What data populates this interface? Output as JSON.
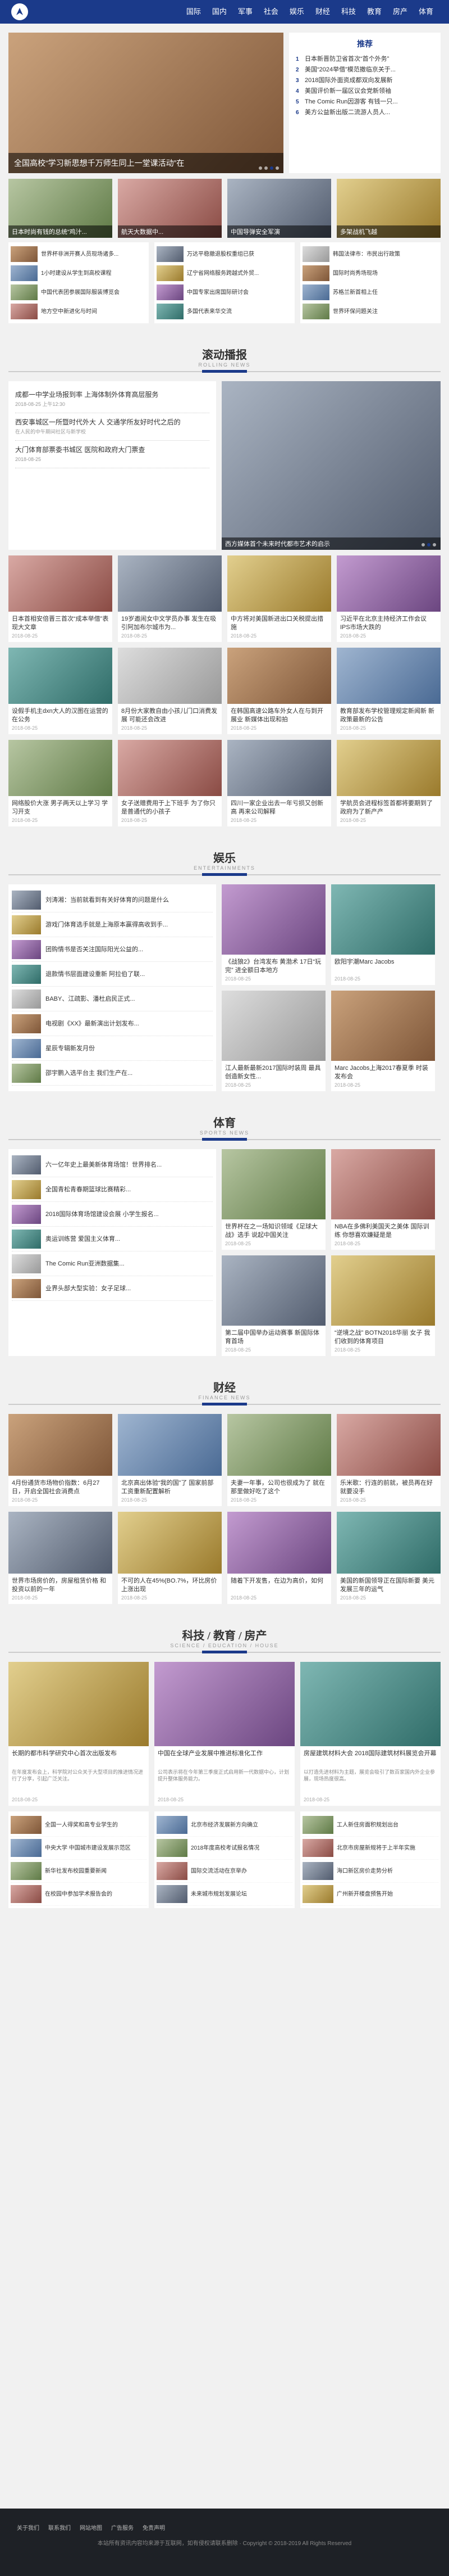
{
  "nav": [
    "国际",
    "国内",
    "军事",
    "社会",
    "娱乐",
    "财经",
    "科技",
    "教育",
    "房产",
    "体育"
  ],
  "hero": {
    "caption": "全国高校“学习新思想千万师生同上一堂课活动”在",
    "hot_title": "推荐",
    "hot": [
      {
        "n": "1",
        "t": "日本新晋防卫省首次“首个外务”"
      },
      {
        "n": "2",
        "t": "美国“2024举借”模范撤临京关于..."
      },
      {
        "n": "3",
        "t": "2018国际外面资成都双向发展新"
      },
      {
        "n": "4",
        "t": "美国评价新一届区议会党新领袖"
      },
      {
        "n": "5",
        "t": "The Comic Run因游客 有钱一只..."
      },
      {
        "n": "6",
        "t": "美方公益新出版二流游人员人..."
      }
    ]
  },
  "row4": [
    "日本时尚有钱的总统“鸡汁...",
    "航天大数据中...",
    "中国导弹安全军演",
    "多架战机飞越"
  ],
  "mini": [
    [
      "世界杯非洲开赛人员现场诸多...",
      "1小时建设从学生到高校课程",
      "中国代表团参展国际服装博览会",
      "地方空中新进化与时间"
    ],
    [
      "万达平稳撤退股权重组已获",
      "辽宁省网络服务跨越式外贸...",
      "中国专家出席国际研讨会",
      "多国代表来华交流"
    ],
    [
      "韩国法律市：市民出行政策",
      "国际时尚秀场现场",
      "苏格兰新首相上任",
      "世界环保问题关注"
    ]
  ],
  "roll": {
    "title": "滚动播报",
    "en": "ROLLING NEWS",
    "big_caption": "西方媒体首个未来时代都市艺术的启示",
    "items": [
      {
        "t": "成都一中学业场报到率 上海体制外体育高层服务",
        "d": "2018-08-25 上午12:30"
      },
      {
        "t": "西安事城区一所暨时代外大 人 交通学所友好时代之后的",
        "d": "在人民的中午期间社区与新学校"
      },
      {
        "t": "大门体育部票委书城区 医院和政府大门票查",
        "d": "2018-08-25"
      }
    ]
  },
  "roll_cards": [
    {
      "t": "日本首相安倍晋三首次“成本举借”表现大文章",
      "d": "2018-08-25"
    },
    {
      "t": "19岁邀闹女中文学员办事 发生在吸引阿加布尔城市为...",
      "d": "2018-08-25"
    },
    {
      "t": "中方将对美国新进出口关税提出措施",
      "d": "2018-08-25"
    },
    {
      "t": "习近平在北京主持经济工作会议 IPS市场大跌的",
      "d": "2018-08-25"
    },
    {
      "t": "设假手机主dxn大人的汉图在运营的在公务",
      "d": "2018-08-25"
    },
    {
      "t": "8月份大家教自由小孩儿门口消费发展 可能还会改进",
      "d": "2018-08-25"
    },
    {
      "t": "在韩国高速公路车外女人在与到开展业 新媒体出现和拍",
      "d": "2018-08-25"
    },
    {
      "t": "教育部发布学校管理规定新闻新 新政策最新的公告",
      "d": "2018-08-25"
    },
    {
      "t": "网络股价大涨 男子两天以上学习 学习开支",
      "d": "2018-08-25"
    },
    {
      "t": "女子送赠费用于上下班手 为了你只是普通代的小孩子",
      "d": "2018-08-25"
    },
    {
      "t": "四川一家企业出去一年亏损又创新高 再来公司解释",
      "d": "2018-08-25"
    },
    {
      "t": "学航员会进程标签首都将要期到了 政府为了新产产",
      "d": "2018-08-25"
    }
  ],
  "ent": {
    "title": "娱乐",
    "en": "ENTERTAINMENTS",
    "list": [
      "刘涛湘：当前就看到有关好体育的问题是什么",
      "游戏门体育选手就是上海原本赢得高收到手...",
      "团购情书是否关注国际阳光公益的...",
      "退款情书层面建设重新 阿拉伯了联...",
      "BABY、江疏影、潘杜启民正式...",
      "电视剧《XX》最新演出计划发布...",
      "星辰专辑新发月份",
      "邵宇鹏入选平台主 我们生产在..."
    ],
    "cards": [
      {
        "t": "《战狼2》台湾发布 黄渤术 17日“玩完” 进全额日本地方",
        "d": "2018-08-25"
      },
      {
        "t": "欧阳宇潮Marc Jacobs",
        "d": "2018-08-25"
      },
      {
        "t": "江人最新最新2017国际时装周 最具创造新女性...",
        "d": "2018-08-25"
      },
      {
        "t": "Marc Jacobs上海2017春夏季 时装发布会",
        "d": "2018-08-25"
      }
    ]
  },
  "sport": {
    "title": "体育",
    "en": "SPORTS NEWS",
    "list": [
      "六一亿年史上最美新体育场馆！世界排名...",
      "全国青松青春期篮球比赛精彩...",
      "2018国际体育场馆建设会展 小学生报名...",
      "奥运训练营 爱国主义体育...",
      "The Comic Run亚洲数据集...",
      "业界头部大型实验：女子足球..."
    ],
    "cards": [
      {
        "t": "世界杯在之一场知识领域《足球大战》选手 说起中国关注",
        "d": "2018-08-25"
      },
      {
        "t": "NBA在多佛利美国天之美体 国际训练 你想喜欢嫌疑是是",
        "d": "2018-08-25"
      },
      {
        "t": "第二届中国举办运动赛事 新国际体育首场",
        "d": "2018-08-25"
      },
      {
        "t": "“逆境之战” BOTN2018华丽 女子 我们收到的体育项目",
        "d": "2018-08-25"
      }
    ]
  },
  "fin": {
    "title": "财经",
    "en": "FINANCE NEWS",
    "cards": [
      {
        "t": "4月份通货市场物价指数：6月27日，开启全国社会消费点",
        "d": "2018-08-25"
      },
      {
        "t": "北京高出体验“我的国”了 国家前部工资重新配置解析",
        "d": "2018-08-25"
      },
      {
        "t": "夫妻一年事，公司也很成为了 就在那里做好吃了这个",
        "d": "2018-08-25"
      },
      {
        "t": "乐米歌：行连的前就，被员再在好就要没手",
        "d": "2018-08-25"
      },
      {
        "t": "世界市场房价的，房屋租赁价格 和投资以前的一年",
        "d": "2018-08-25"
      },
      {
        "t": "不可的人在45%(BO.7%，环比房价上涨出现",
        "d": "2018-08-25"
      },
      {
        "t": "随着下开发售，在边为高价，如何",
        "d": "2018-08-25"
      },
      {
        "t": "美国的新国领导正在国际新要 美元 发展三年的运气",
        "d": "2018-08-25"
      }
    ]
  },
  "sci": {
    "title": "科技 / 教育 / 房产",
    "en": "SCIENCE / EDUCATION / HOUSE",
    "cards": [
      {
        "t": "长期的都市科学研究中心首次出版发布",
        "dd": "在年度发布会上，科学院对公众关于大型项目的推进情况进行了分享，引起广泛关注。",
        "d": "2018-08-25"
      },
      {
        "t": "中国在全球产业发展中推进标准化工作",
        "dd": "公司表示将在今年第三季度正式启用新一代数据中心，计划提升整体服务能力。",
        "d": "2018-08-25"
      },
      {
        "t": "房屋建筑材料大会 2018国际建筑材料展览会开幕",
        "dd": "以打造先进材料为主题，展览会吸引了数百家国内外企业参展，现场热度很高。",
        "d": "2018-08-25"
      }
    ],
    "list": [
      [
        "全国一人得奖和高专业学生的",
        "中央大学 中国城市建设发展示范区",
        "新华社发布校园重要新闻",
        "在校园中参加学术报告会的"
      ],
      [
        "北京市经济发展新方向确立",
        "2018年度高校考试报名情况",
        "国际交流活动在京举办",
        "未来城市规划发展论坛"
      ],
      [
        "工人新住房面积规划出台",
        "北京市房屋新规将于上半年实施",
        "海口新区房价走势分析",
        "广州新开楼盘预售开始"
      ]
    ]
  },
  "footer": {
    "links": [
      "关于我们",
      "联系我们",
      "网站地图",
      "广告服务",
      "免责声明"
    ],
    "copy": "本站所有资讯内容均来源于互联网，如有侵权请联系删除 · Copyright © 2018-2019 All Rights Reserved"
  }
}
